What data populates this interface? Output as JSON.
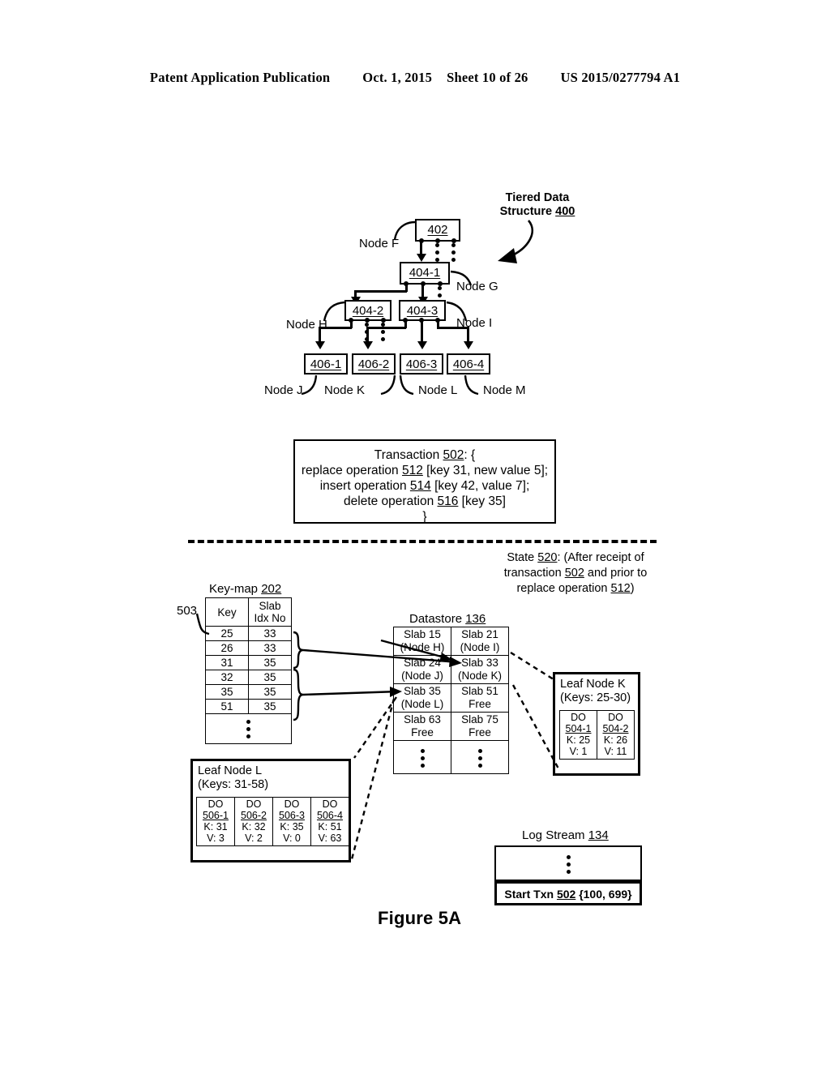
{
  "header": {
    "publication": "Patent Application Publication",
    "date": "Oct. 1, 2015",
    "sheet": "Sheet 10 of 26",
    "patent_number": "US 2015/0277794 A1"
  },
  "figure": {
    "caption": "Figure 5A"
  },
  "tiered_structure": {
    "title_line1": "Tiered Data",
    "title_line2_text": "Structure ",
    "title_line2_ref": "400",
    "nodes": [
      {
        "id": "402",
        "label": "Node F"
      },
      {
        "id": "404-1",
        "label": "Node G"
      },
      {
        "id": "404-2",
        "label": "Node H"
      },
      {
        "id": "404-3",
        "label": "Node I"
      },
      {
        "id": "406-1",
        "label": "Node J"
      },
      {
        "id": "406-2",
        "label": "Node K"
      },
      {
        "id": "406-3",
        "label": "Node L"
      },
      {
        "id": "406-4",
        "label": "Node M"
      }
    ]
  },
  "transaction": {
    "line1_a": "Transaction ",
    "line1_ref": "502",
    "line1_b": ": {",
    "line2_a": "replace operation ",
    "line2_ref": "512",
    "line2_b": " [key 31, new value 5];",
    "line3_a": "insert operation ",
    "line3_ref": "514",
    "line3_b": " [key 42, value 7];",
    "line4_a": "delete operation ",
    "line4_ref": "516",
    "line4_b": " [key 35]",
    "line5": "}"
  },
  "state": {
    "line1_a": "State ",
    "line1_ref": "520",
    "line1_b": ": (After receipt of",
    "line2_a": "transaction ",
    "line2_ref": "502",
    "line2_b": " and prior to",
    "line3_a": "replace operation ",
    "line3_ref": "512",
    "line3_b": ")"
  },
  "keymap": {
    "title_text": "Key-map ",
    "title_ref": "202",
    "callout": "503",
    "headers": [
      "Key",
      "Slab\nIdx No"
    ],
    "header_key": "Key",
    "header_slab_line1": "Slab",
    "header_slab_line2": "Idx No",
    "rows": [
      {
        "key": "25",
        "slab": "33"
      },
      {
        "key": "26",
        "slab": "33"
      },
      {
        "key": "31",
        "slab": "35"
      },
      {
        "key": "32",
        "slab": "35"
      },
      {
        "key": "35",
        "slab": "35"
      },
      {
        "key": "51",
        "slab": "35"
      }
    ]
  },
  "datastore": {
    "title_text": "Datastore ",
    "title_ref": "136",
    "cells": [
      {
        "slab": "Slab 15",
        "status": "(Node H)"
      },
      {
        "slab": "Slab 21",
        "status": "(Node I)"
      },
      {
        "slab": "Slab 24",
        "status": "(Node J)"
      },
      {
        "slab": "Slab 33",
        "status": "(Node K)"
      },
      {
        "slab": "Slab 35",
        "status": "(Node L)"
      },
      {
        "slab": "Slab 51",
        "status": "Free"
      },
      {
        "slab": "Slab 63",
        "status": "Free"
      },
      {
        "slab": "Slab 75",
        "status": "Free"
      }
    ]
  },
  "leaf_node_k": {
    "title": "Leaf Node K",
    "keys": "(Keys: 25-30)",
    "data_objects": [
      {
        "do": "DO",
        "ref": "504-1",
        "k": "K: 25",
        "v": "V: 1"
      },
      {
        "do": "DO",
        "ref": "504-2",
        "k": "K: 26",
        "v": "V: 11"
      }
    ]
  },
  "leaf_node_l": {
    "title": "Leaf Node L",
    "keys": "(Keys: 31-58)",
    "data_objects": [
      {
        "do": "DO",
        "ref": "506-1",
        "k": "K: 31",
        "v": "V: 3"
      },
      {
        "do": "DO",
        "ref": "506-2",
        "k": "K: 32",
        "v": "V: 2"
      },
      {
        "do": "DO",
        "ref": "506-3",
        "k": "K: 35",
        "v": "V: 0"
      },
      {
        "do": "DO",
        "ref": "506-4",
        "k": "K: 51",
        "v": "V: 63"
      }
    ]
  },
  "log_stream": {
    "title_text": "Log Stream ",
    "title_ref": "134",
    "entry_a": "Start Txn ",
    "entry_ref": "502",
    "entry_b": " {100, 699}"
  }
}
